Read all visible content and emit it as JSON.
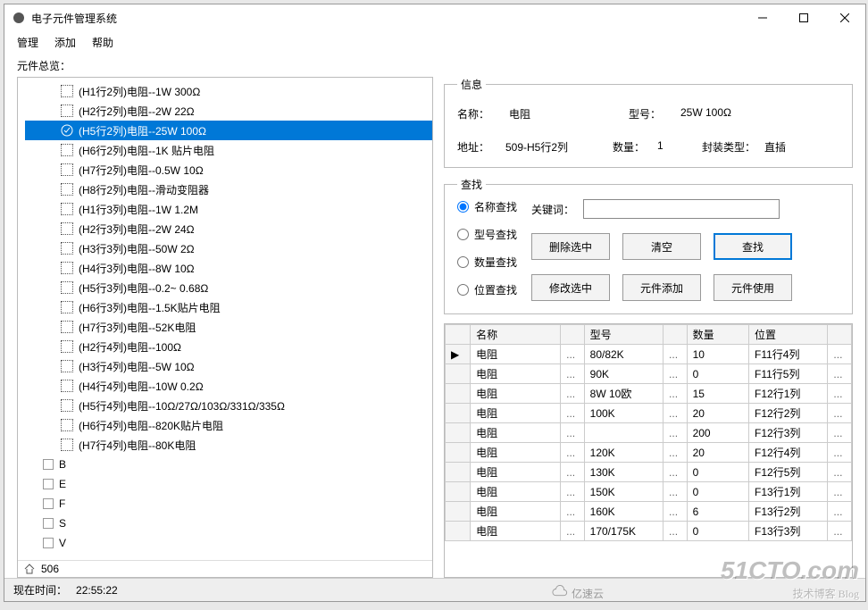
{
  "title": "电子元件管理系统",
  "menubar": {
    "manage": "管理",
    "add": "添加",
    "help": "帮助"
  },
  "overview_label": "元件总览：",
  "tree": {
    "items": [
      {
        "label": "(H1行2列)电阻--1W 300Ω"
      },
      {
        "label": "(H2行2列)电阻--2W 22Ω"
      },
      {
        "label": "(H5行2列)电阻--25W 100Ω",
        "selected": true,
        "check": true
      },
      {
        "label": "(H6行2列)电阻--1K 贴片电阻"
      },
      {
        "label": "(H7行2列)电阻--0.5W 10Ω"
      },
      {
        "label": "(H8行2列)电阻--滑动变阻器"
      },
      {
        "label": "(H1行3列)电阻--1W 1.2M"
      },
      {
        "label": "(H2行3列)电阻--2W 24Ω"
      },
      {
        "label": "(H3行3列)电阻--50W 2Ω"
      },
      {
        "label": "(H4行3列)电阻--8W 10Ω"
      },
      {
        "label": "(H5行3列)电阻--0.2~ 0.68Ω"
      },
      {
        "label": "(H6行3列)电阻--1.5K贴片电阻"
      },
      {
        "label": "(H7行3列)电阻--52K电阻"
      },
      {
        "label": "(H2行4列)电阻--100Ω"
      },
      {
        "label": "(H3行4列)电阻--5W 10Ω"
      },
      {
        "label": "(H4行4列)电阻--10W 0.2Ω"
      },
      {
        "label": "(H5行4列)电阻--10Ω/27Ω/103Ω/331Ω/335Ω"
      },
      {
        "label": "(H6行4列)电阻--820K贴片电阻"
      },
      {
        "label": "(H7行4列)电阻--80K电阻"
      }
    ],
    "cats": [
      {
        "label": "B"
      },
      {
        "label": "E"
      },
      {
        "label": "F"
      },
      {
        "label": "S"
      },
      {
        "label": "V"
      }
    ],
    "count": "506"
  },
  "info": {
    "legend": "信息",
    "name_lbl": "名称：",
    "name_val": "电阻",
    "model_lbl": "型号：",
    "model_val": "25W 100Ω",
    "addr_lbl": "地址：",
    "addr_val": "509-H5行2列",
    "qty_lbl": "数量：",
    "qty_val": "1",
    "pkg_lbl": "封装类型：",
    "pkg_val": "直插"
  },
  "search": {
    "legend": "查找",
    "radio": {
      "name": "名称查找",
      "model": "型号查找",
      "qty": "数量查找",
      "loc": "位置查找"
    },
    "kw_lbl": "关键词：",
    "btns": {
      "del": "删除选中",
      "clear": "清空",
      "find": "查找",
      "mod": "修改选中",
      "addc": "元件添加",
      "use": "元件使用"
    }
  },
  "grid": {
    "headers": {
      "name": "名称",
      "model": "型号",
      "qty": "数量",
      "loc": "位置"
    },
    "rows": [
      {
        "name": "电阻",
        "model": "80/82K",
        "qty": "10",
        "loc": "F11行4列",
        "cur": true
      },
      {
        "name": "电阻",
        "model": "90K",
        "qty": "0",
        "loc": "F11行5列"
      },
      {
        "name": "电阻",
        "model": "8W 10欧",
        "qty": "15",
        "loc": "F12行1列"
      },
      {
        "name": "电阻",
        "model": "100K",
        "qty": "20",
        "loc": "F12行2列"
      },
      {
        "name": "电阻",
        "model": "",
        "qty": "200",
        "loc": "F12行3列"
      },
      {
        "name": "电阻",
        "model": "120K",
        "qty": "20",
        "loc": "F12行4列"
      },
      {
        "name": "电阻",
        "model": "130K",
        "qty": "0",
        "loc": "F12行5列"
      },
      {
        "name": "电阻",
        "model": "150K",
        "qty": "0",
        "loc": "F13行1列"
      },
      {
        "name": "电阻",
        "model": "160K",
        "qty": "6",
        "loc": "F13行2列"
      },
      {
        "name": "电阻",
        "model": "170/175K",
        "qty": "0",
        "loc": "F13行3列"
      }
    ]
  },
  "status": {
    "lbl": "现在时间：",
    "val": "22:55:22"
  },
  "watermark": {
    "main": "51CTO.com",
    "sub": "技术博客  Blog"
  },
  "yun": "亿速云"
}
